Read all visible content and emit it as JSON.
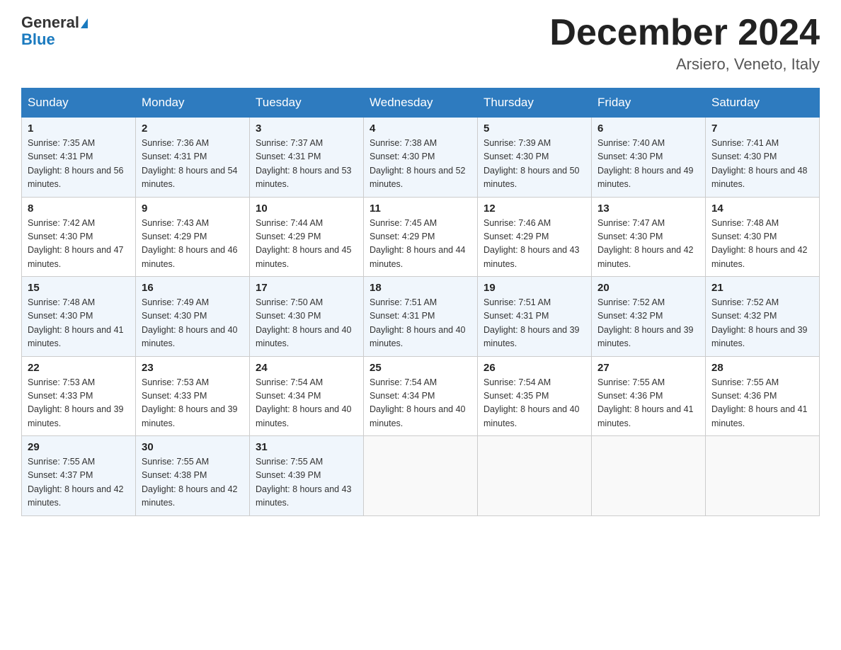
{
  "header": {
    "logo_general": "General",
    "logo_blue": "Blue",
    "title": "December 2024",
    "location": "Arsiero, Veneto, Italy"
  },
  "weekdays": [
    "Sunday",
    "Monday",
    "Tuesday",
    "Wednesday",
    "Thursday",
    "Friday",
    "Saturday"
  ],
  "weeks": [
    [
      {
        "day": "1",
        "sunrise": "7:35 AM",
        "sunset": "4:31 PM",
        "daylight": "8 hours and 56 minutes."
      },
      {
        "day": "2",
        "sunrise": "7:36 AM",
        "sunset": "4:31 PM",
        "daylight": "8 hours and 54 minutes."
      },
      {
        "day": "3",
        "sunrise": "7:37 AM",
        "sunset": "4:31 PM",
        "daylight": "8 hours and 53 minutes."
      },
      {
        "day": "4",
        "sunrise": "7:38 AM",
        "sunset": "4:30 PM",
        "daylight": "8 hours and 52 minutes."
      },
      {
        "day": "5",
        "sunrise": "7:39 AM",
        "sunset": "4:30 PM",
        "daylight": "8 hours and 50 minutes."
      },
      {
        "day": "6",
        "sunrise": "7:40 AM",
        "sunset": "4:30 PM",
        "daylight": "8 hours and 49 minutes."
      },
      {
        "day": "7",
        "sunrise": "7:41 AM",
        "sunset": "4:30 PM",
        "daylight": "8 hours and 48 minutes."
      }
    ],
    [
      {
        "day": "8",
        "sunrise": "7:42 AM",
        "sunset": "4:30 PM",
        "daylight": "8 hours and 47 minutes."
      },
      {
        "day": "9",
        "sunrise": "7:43 AM",
        "sunset": "4:29 PM",
        "daylight": "8 hours and 46 minutes."
      },
      {
        "day": "10",
        "sunrise": "7:44 AM",
        "sunset": "4:29 PM",
        "daylight": "8 hours and 45 minutes."
      },
      {
        "day": "11",
        "sunrise": "7:45 AM",
        "sunset": "4:29 PM",
        "daylight": "8 hours and 44 minutes."
      },
      {
        "day": "12",
        "sunrise": "7:46 AM",
        "sunset": "4:29 PM",
        "daylight": "8 hours and 43 minutes."
      },
      {
        "day": "13",
        "sunrise": "7:47 AM",
        "sunset": "4:30 PM",
        "daylight": "8 hours and 42 minutes."
      },
      {
        "day": "14",
        "sunrise": "7:48 AM",
        "sunset": "4:30 PM",
        "daylight": "8 hours and 42 minutes."
      }
    ],
    [
      {
        "day": "15",
        "sunrise": "7:48 AM",
        "sunset": "4:30 PM",
        "daylight": "8 hours and 41 minutes."
      },
      {
        "day": "16",
        "sunrise": "7:49 AM",
        "sunset": "4:30 PM",
        "daylight": "8 hours and 40 minutes."
      },
      {
        "day": "17",
        "sunrise": "7:50 AM",
        "sunset": "4:30 PM",
        "daylight": "8 hours and 40 minutes."
      },
      {
        "day": "18",
        "sunrise": "7:51 AM",
        "sunset": "4:31 PM",
        "daylight": "8 hours and 40 minutes."
      },
      {
        "day": "19",
        "sunrise": "7:51 AM",
        "sunset": "4:31 PM",
        "daylight": "8 hours and 39 minutes."
      },
      {
        "day": "20",
        "sunrise": "7:52 AM",
        "sunset": "4:32 PM",
        "daylight": "8 hours and 39 minutes."
      },
      {
        "day": "21",
        "sunrise": "7:52 AM",
        "sunset": "4:32 PM",
        "daylight": "8 hours and 39 minutes."
      }
    ],
    [
      {
        "day": "22",
        "sunrise": "7:53 AM",
        "sunset": "4:33 PM",
        "daylight": "8 hours and 39 minutes."
      },
      {
        "day": "23",
        "sunrise": "7:53 AM",
        "sunset": "4:33 PM",
        "daylight": "8 hours and 39 minutes."
      },
      {
        "day": "24",
        "sunrise": "7:54 AM",
        "sunset": "4:34 PM",
        "daylight": "8 hours and 40 minutes."
      },
      {
        "day": "25",
        "sunrise": "7:54 AM",
        "sunset": "4:34 PM",
        "daylight": "8 hours and 40 minutes."
      },
      {
        "day": "26",
        "sunrise": "7:54 AM",
        "sunset": "4:35 PM",
        "daylight": "8 hours and 40 minutes."
      },
      {
        "day": "27",
        "sunrise": "7:55 AM",
        "sunset": "4:36 PM",
        "daylight": "8 hours and 41 minutes."
      },
      {
        "day": "28",
        "sunrise": "7:55 AM",
        "sunset": "4:36 PM",
        "daylight": "8 hours and 41 minutes."
      }
    ],
    [
      {
        "day": "29",
        "sunrise": "7:55 AM",
        "sunset": "4:37 PM",
        "daylight": "8 hours and 42 minutes."
      },
      {
        "day": "30",
        "sunrise": "7:55 AM",
        "sunset": "4:38 PM",
        "daylight": "8 hours and 42 minutes."
      },
      {
        "day": "31",
        "sunrise": "7:55 AM",
        "sunset": "4:39 PM",
        "daylight": "8 hours and 43 minutes."
      },
      null,
      null,
      null,
      null
    ]
  ]
}
